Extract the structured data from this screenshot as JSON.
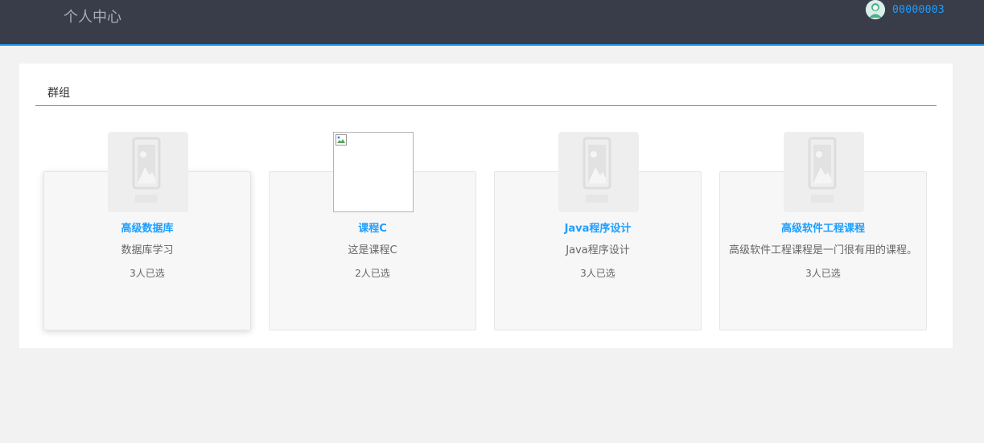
{
  "header": {
    "title": "个人中心",
    "username": "00000003",
    "avatar_icon": "user-avatar-icon"
  },
  "colors": {
    "header_bg": "#393d49",
    "accent": "#1e9fff",
    "page_bg": "#f2f2f2"
  },
  "panel": {
    "title": "群组"
  },
  "courses": [
    {
      "name": "高级数据库",
      "desc": "数据库学习",
      "count": "3人已选",
      "image": "placeholder"
    },
    {
      "name": "课程C",
      "desc": "这是课程C",
      "count": "2人已选",
      "image": "broken"
    },
    {
      "name": "Java程序设计",
      "desc": "Java程序设计",
      "count": "3人已选",
      "image": "placeholder"
    },
    {
      "name": "高级软件工程课程",
      "desc": "高级软件工程课程是一门很有用的课程。",
      "count": "3人已选",
      "image": "placeholder"
    }
  ]
}
